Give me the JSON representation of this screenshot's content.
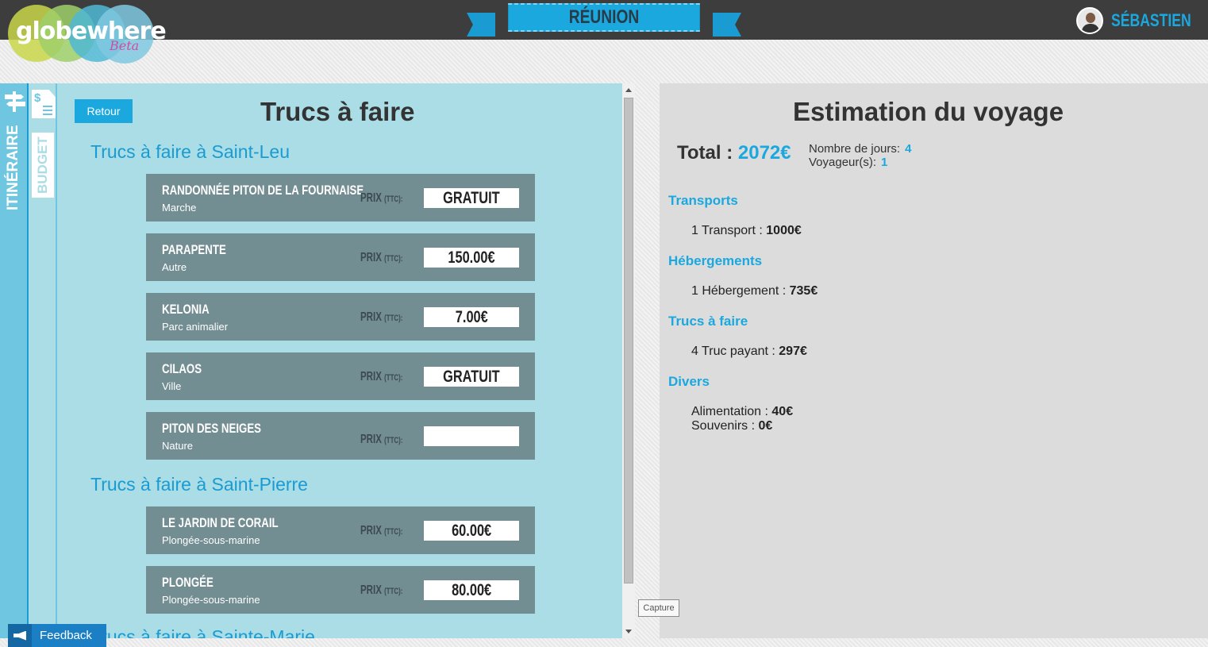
{
  "header": {
    "logo_text": "globewhere",
    "logo_badge": "Beta",
    "destination": "RÉUNION",
    "username": "SÉBASTIEN"
  },
  "sidebar": {
    "tabs": [
      {
        "label": "ITINÉRAIRE",
        "icon": "signpost-icon"
      },
      {
        "label": "BUDGET",
        "icon": "budget-document-icon"
      }
    ]
  },
  "activities_panel": {
    "back_label": "Retour",
    "title": "Trucs à faire",
    "price_label": "PRIX",
    "price_suffix": "(TTC):",
    "groups": [
      {
        "title": "Trucs à faire à Saint-Leu",
        "items": [
          {
            "name": "RANDONNÉE PITON DE LA FOURNAISE",
            "category": "Marche",
            "price": "GRATUIT"
          },
          {
            "name": "PARAPENTE",
            "category": "Autre",
            "price": "150.00€"
          },
          {
            "name": "KELONIA",
            "category": "Parc animalier",
            "price": "7.00€"
          },
          {
            "name": "CILAOS",
            "category": "Ville",
            "price": "GRATUIT"
          },
          {
            "name": "PITON DES NEIGES",
            "category": "Nature",
            "price": ""
          }
        ]
      },
      {
        "title": "Trucs à faire à Saint-Pierre",
        "items": [
          {
            "name": "LE JARDIN DE CORAIL",
            "category": "Plongée-sous-marine",
            "price": "60.00€"
          },
          {
            "name": "PLONGÉE",
            "category": "Plongée-sous-marine",
            "price": "80.00€"
          }
        ]
      },
      {
        "title": "Trucs à faire à Sainte-Marie",
        "items": []
      }
    ]
  },
  "estimate_panel": {
    "title": "Estimation du voyage",
    "total_label": "Total :",
    "total_value": "2072€",
    "days_label": "Nombre de jours:",
    "days_value": "4",
    "travelers_label": "Voyageur(s):",
    "travelers_value": "1",
    "categories": [
      {
        "title": "Transports",
        "lines": [
          {
            "label": "1 Transport : ",
            "value": "1000€"
          }
        ]
      },
      {
        "title": "Hébergements",
        "lines": [
          {
            "label": "1 Hébergement : ",
            "value": "735€"
          }
        ]
      },
      {
        "title": "Trucs à faire",
        "lines": [
          {
            "label": "4 Truc payant : ",
            "value": "297€"
          }
        ]
      },
      {
        "title": "Divers",
        "lines": [
          {
            "label": "Alimentation : ",
            "value": "40€"
          },
          {
            "label": "Souvenirs : ",
            "value": "0€"
          }
        ]
      }
    ]
  },
  "tooltip": {
    "text": "Capture"
  },
  "feedback": {
    "label": "Feedback",
    "icon": "megaphone-icon"
  },
  "colors": {
    "accent": "#1aa8df",
    "topbar": "#3d3d3d",
    "card": "#738e93",
    "panel_left": "#abdde6",
    "panel_right": "#dcdcdc"
  }
}
